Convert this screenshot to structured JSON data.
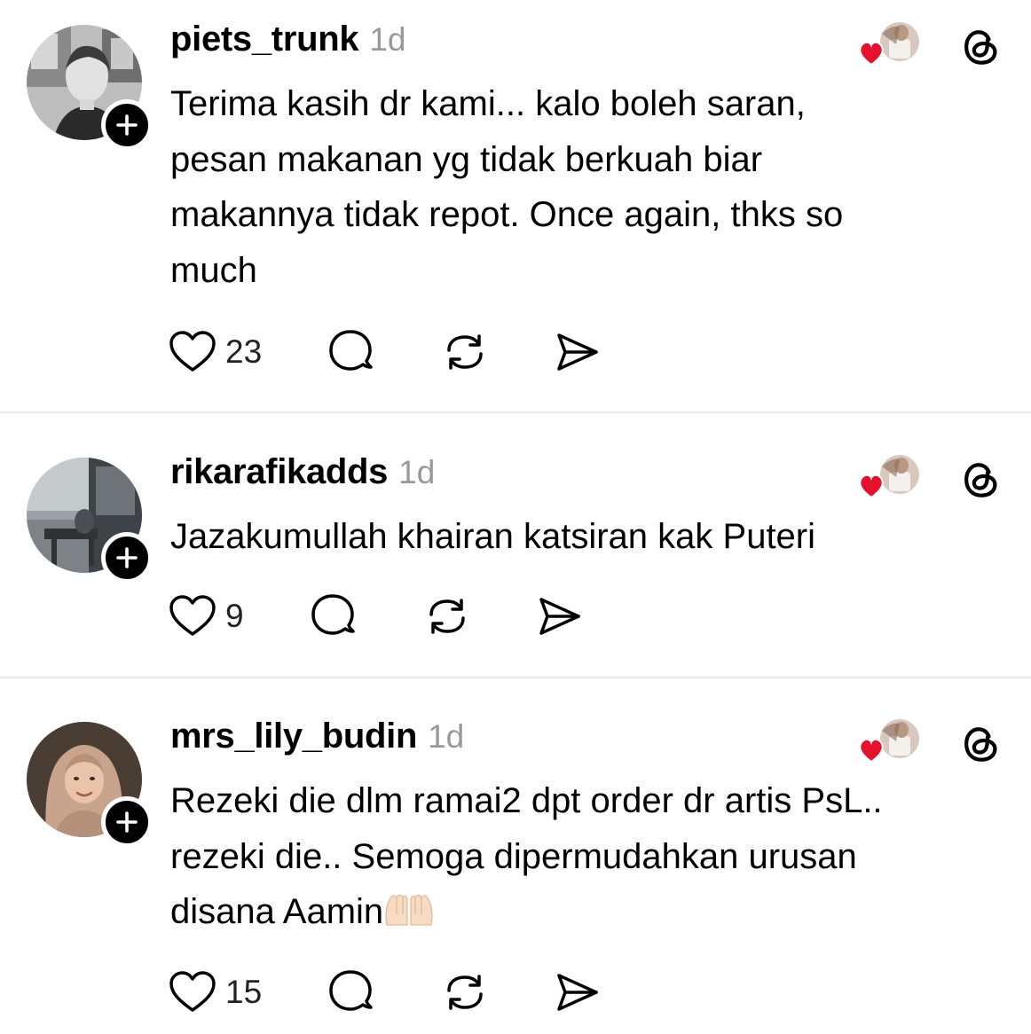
{
  "posts": [
    {
      "username": "piets_trunk",
      "time": "1d",
      "lines": [
        "Terima kasih dr kami... kalo boleh saran,",
        "pesan makanan yg tidak berkuah biar",
        "makannya tidak repot. Once again, thks so",
        "much"
      ],
      "likes": "23",
      "avatar": "grey-photo"
    },
    {
      "username": "rikarafikadds",
      "time": "1d",
      "lines": [
        "Jazakumullah khairan katsiran kak Puteri"
      ],
      "likes": "9",
      "avatar": "dim-room-photo"
    },
    {
      "username": "mrs_lily_budin",
      "time": "1d",
      "lines": [
        "Rezeki die dlm ramai2 dpt order dr artis PsL..",
        "rezeki die.. Semoga dipermudahkan urusan",
        "disana Aamin"
      ],
      "trailing_emoji": "raised-palms-emoji",
      "likes": "15",
      "avatar": "hijab-portrait"
    }
  ],
  "icons": {
    "follow": "plus-icon",
    "liked_by": "heart-avatar-icon",
    "app": "threads-icon",
    "like": "heart-outline-icon",
    "reply": "speech-bubble-icon",
    "repost": "repost-arrows-icon",
    "share": "send-icon"
  },
  "colors": {
    "text": "#000000",
    "timestamp": "#999999",
    "heart_badge": "#e8112d",
    "divider": "#e9e9e9"
  }
}
